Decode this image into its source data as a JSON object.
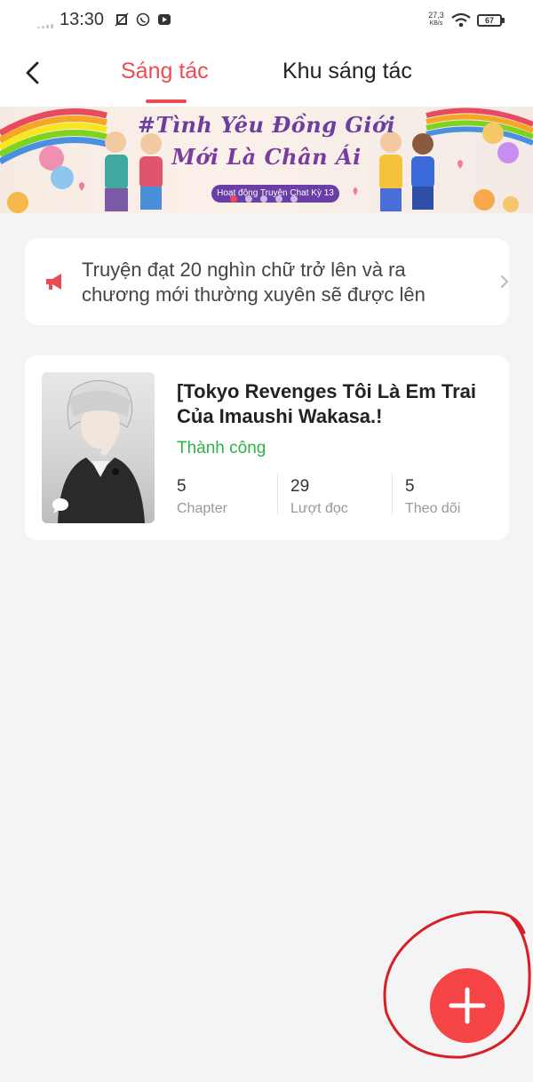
{
  "status_bar": {
    "time": "13:30",
    "net_speed_value": "27,3",
    "net_speed_unit": "KB/s",
    "battery": "67"
  },
  "nav": {
    "back_icon": "chevron-left-icon",
    "tabs": [
      {
        "label": "Sáng tác",
        "active": true
      },
      {
        "label": "Khu sáng tác",
        "active": false
      }
    ],
    "accent_color": "#ef4a54"
  },
  "banner": {
    "line1": "#Tình Yêu Đồng Giới",
    "line2": "Mới Là Chân Ái",
    "pill": "Hoạt động Truyện Chat Kỳ 13"
  },
  "notice": {
    "icon": "megaphone-icon",
    "text": "Truyện đạt 20 nghìn chữ trở lên và ra chương mới thường xuyên sẽ được lên"
  },
  "story": {
    "title": "[Tokyo Revenges Tôi Là Em Trai Của Imaushi Wakasa.!",
    "status": "Thành công",
    "status_color": "#2cb34a",
    "stats": [
      {
        "value": "5",
        "label": "Chapter"
      },
      {
        "value": "29",
        "label": "Lượt đọc"
      },
      {
        "value": "5",
        "label": "Theo dõi"
      }
    ]
  },
  "fab": {
    "icon": "plus-icon",
    "color": "#f44446"
  }
}
